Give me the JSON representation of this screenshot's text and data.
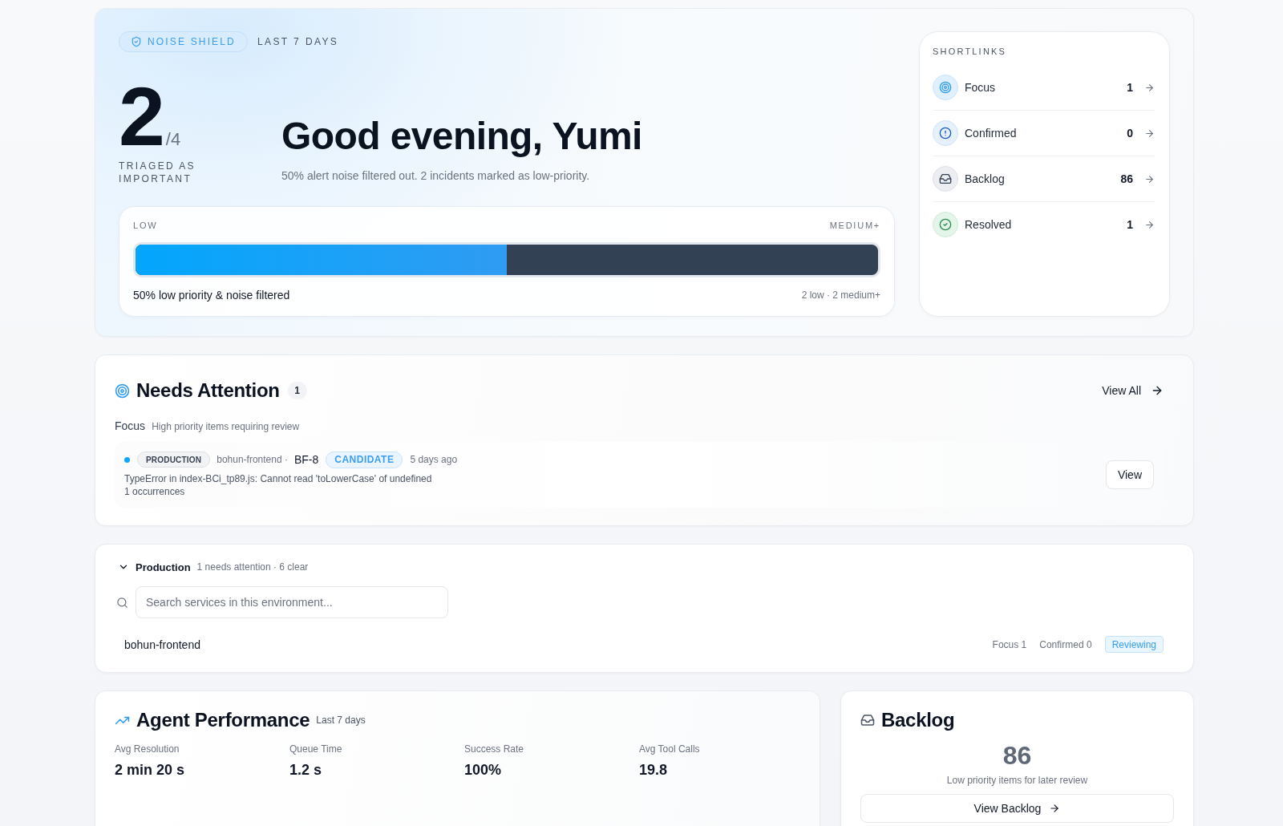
{
  "hero": {
    "badge": "NOISE SHIELD",
    "period": "LAST 7 DAYS",
    "important": "2",
    "total": "/4",
    "caption": "TRIAGED AS IMPORTANT",
    "greeting": "Good evening, Yumi",
    "summary": "50% alert noise filtered out. 2 incidents marked as low-priority.",
    "noise_meter": {
      "left_label": "LOW",
      "right_label": "MEDIUM+",
      "level": 0.5,
      "caption": "50% low priority & noise filtered",
      "breakdown": "2 low · 2 medium+"
    }
  },
  "shortlinks": {
    "title": "SHORTLINKS",
    "items": [
      {
        "kind": "focus",
        "label": "Focus",
        "count": "1"
      },
      {
        "kind": "confirmed",
        "label": "Confirmed",
        "count": "0"
      },
      {
        "kind": "backlog",
        "label": "Backlog",
        "count": "86"
      },
      {
        "kind": "resolved",
        "label": "Resolved",
        "count": "1"
      }
    ]
  },
  "needs_attention": {
    "title": "Needs Attention",
    "count": "1",
    "view_all": "View All",
    "group": "Focus",
    "group_hint": "High priority items requiring review",
    "items": [
      {
        "environment": "PRODUCTION",
        "service": "bohun-frontend ·",
        "id": "BF-8",
        "status": "CANDIDATE",
        "age": "5 days ago",
        "message": "TypeError in index-BCi_tp89.js: Cannot read 'toLowerCase' of undefined",
        "occurrences": "1 occurrences",
        "action": "View"
      }
    ]
  },
  "production": {
    "title": "Production",
    "expanded": true,
    "summary": "1 needs attention · 6 clear",
    "search": {
      "placeholder": "Search services in this environment..."
    },
    "services": [
      {
        "name": "bohun-frontend",
        "focus": "Focus 1",
        "confirmed": "Confirmed 0",
        "status": "Reviewing"
      }
    ]
  },
  "agent_performance": {
    "title": "Agent Performance",
    "period": "Last 7 days",
    "metrics": [
      {
        "label": "Avg Resolution",
        "value": "2 min 20 s"
      },
      {
        "label": "Queue Time",
        "value": "1.2 s"
      },
      {
        "label": "Success Rate",
        "value": "100%"
      },
      {
        "label": "Avg Tool Calls",
        "value": "19.8"
      }
    ]
  },
  "backlog": {
    "title": "Backlog",
    "count": "86",
    "caption": "Low priority items for later review",
    "button": "View Backlog"
  }
}
